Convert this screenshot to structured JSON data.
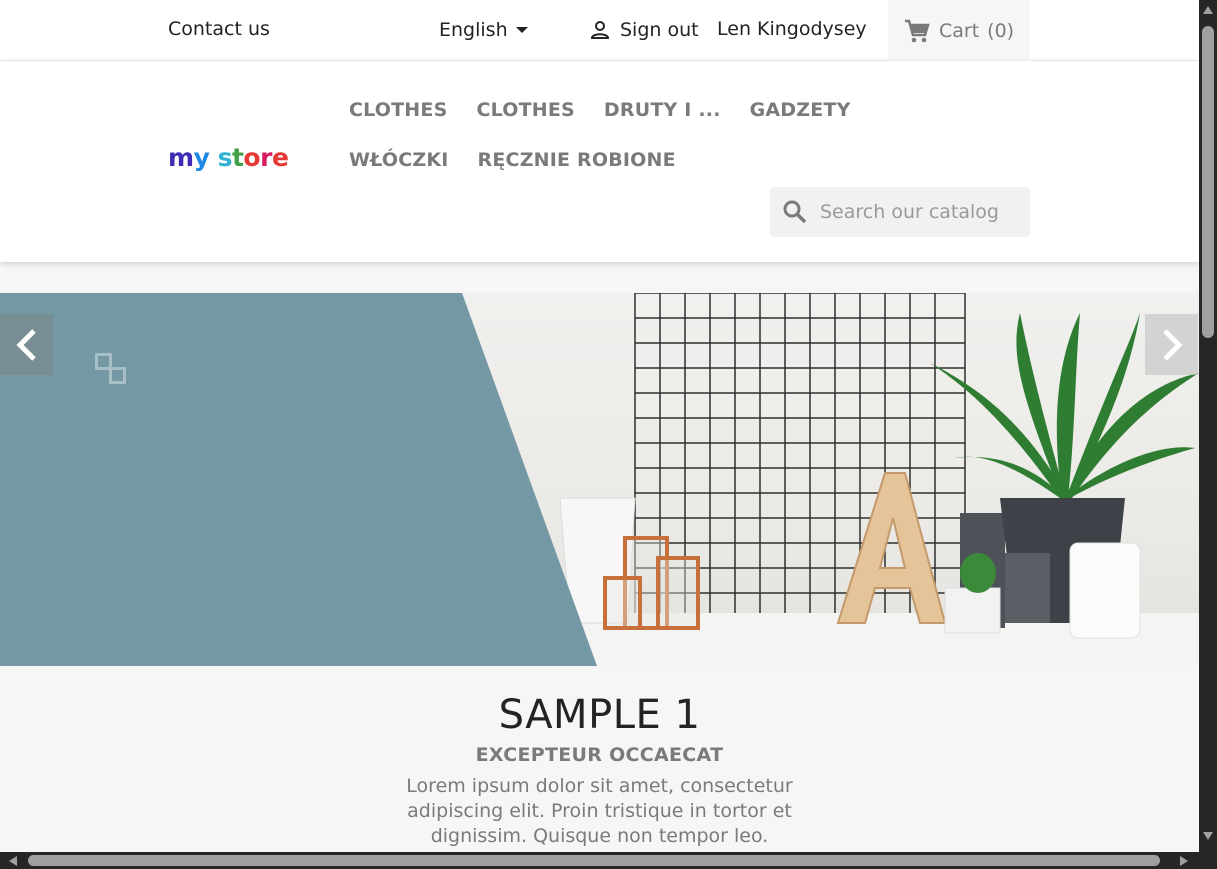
{
  "topbar": {
    "contact": "Contact us",
    "language": "English",
    "sign_out": "Sign out",
    "user_name": "Len Kingodysey",
    "cart_label": "Cart",
    "cart_count": "(0)"
  },
  "header": {
    "logo_text": "my store",
    "logo_letters": [
      {
        "char": "m",
        "color": "#3d2bb5"
      },
      {
        "char": "y",
        "color": "#1e88e5"
      },
      {
        "char": " ",
        "color": "#000000"
      },
      {
        "char": "s",
        "color": "#2db2d2"
      },
      {
        "char": "t",
        "color": "#43a047"
      },
      {
        "char": "o",
        "color": "#e53935"
      },
      {
        "char": "r",
        "color": "#d81b60"
      },
      {
        "char": "e",
        "color": "#e53935"
      }
    ],
    "menu": [
      "CLOTHES",
      "CLOTHES",
      "DRUTY I ...",
      "GADZETY",
      "WŁÓCZKI",
      "RĘCZNIE ROBIONE"
    ],
    "search_placeholder": "Search our catalog"
  },
  "slider": {
    "panel_color": "#7598a5",
    "title": "SAMPLE 1",
    "subtitle": "EXCEPTEUR OCCAECAT",
    "text": "Lorem ipsum dolor sit amet, consectetur adipiscing elit. Proin tristique in tortor et dignissim. Quisque non tempor leo."
  }
}
